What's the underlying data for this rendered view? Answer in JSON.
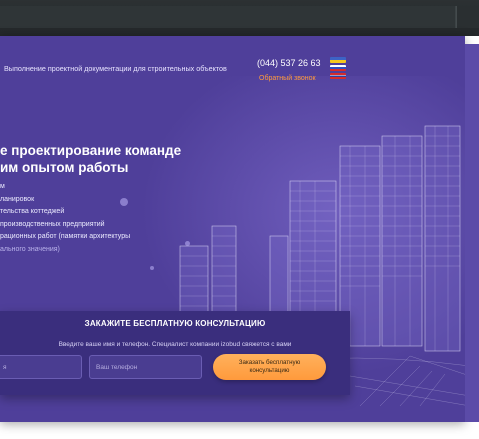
{
  "header": {
    "tagline": "Выполнение проектной документации для строительных объектов",
    "phone": "(044) 537 26 63",
    "callback": "Обратный звонок",
    "languages": [
      "ua",
      "ru",
      "en"
    ]
  },
  "hero": {
    "title_line1": "е проектирование команде",
    "title_line2": "им опытом работы",
    "list": [
      "м",
      "ланировок",
      "тельства коттеджей",
      "производственных предприятий",
      "рационных работ (памятки архитектуры",
      "ального значения)"
    ]
  },
  "form": {
    "title": "ЗАКАЖИТЕ БЕСПЛАТНУЮ КОНСУЛЬТАЦИЮ",
    "subtitle": "Введите ваше имя и телефон. Специалист компании izobud свяжется с вами",
    "name_placeholder": "я",
    "phone_placeholder": "Ваш телефон",
    "button_line1": "Заказать бесплатную",
    "button_line2": "консультацию"
  },
  "colors": {
    "background": "#4f3f9a",
    "form_bg": "#3a2e7d",
    "accent": "#ff9a3c",
    "text": "#ffffff"
  }
}
